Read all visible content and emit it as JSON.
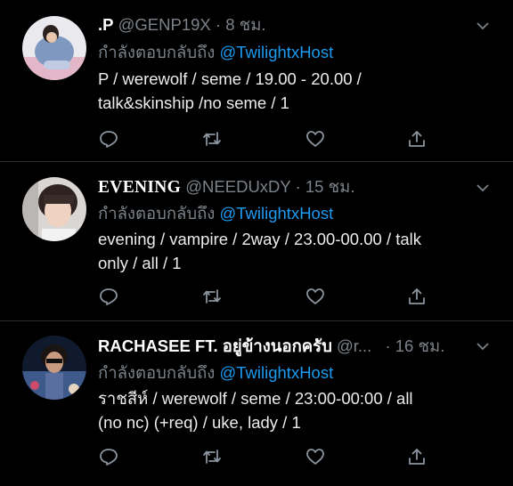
{
  "tweets": [
    {
      "display_name": ".P",
      "handle": "@GENP19X",
      "separator": "·",
      "time": "8 ชม.",
      "reply_prefix": "กำลังตอบกลับถึง",
      "reply_to": "@TwilightxHost",
      "line1": "P / werewolf / seme / 19.00 - 20.00 /",
      "line2": "talk&skinship /no seme / 1"
    },
    {
      "display_name": "EVENING",
      "handle": "@NEEDUxDY",
      "separator": "·",
      "time": "15 ชม.",
      "reply_prefix": "กำลังตอบกลับถึง",
      "reply_to": "@TwilightxHost",
      "line1": "evening / vampire / 2way / 23.00-00.00 / talk",
      "line2": "only / all / 1"
    },
    {
      "display_name": "RACHASEE FT. อยู่ข้างนอกครับ",
      "handle": "@r...",
      "separator": "·",
      "time": "16 ชม.",
      "reply_prefix": "กำลังตอบกลับถึง",
      "reply_to": "@TwilightxHost",
      "line1": "ราชสีห์ / werewolf / seme / 23:00-00:00 / all",
      "line2": "(no nc) (+req) / uke, lady / 1"
    }
  ],
  "colors": {
    "background": "#000000",
    "mention": "#1d9bf0",
    "muted": "#7b8289"
  },
  "icons": [
    "reply-icon",
    "retweet-icon",
    "like-icon",
    "share-icon",
    "chevron-down-icon"
  ]
}
